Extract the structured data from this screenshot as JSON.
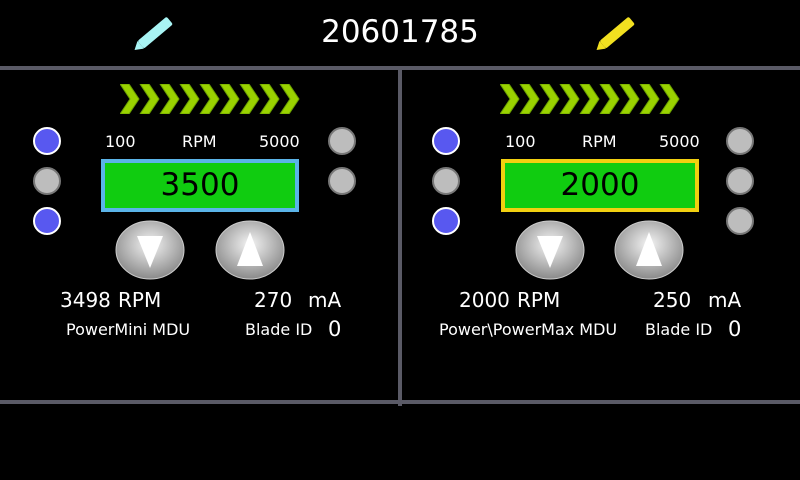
{
  "header": {
    "serial": "20601785",
    "left_pen_color": "#a8f4f4",
    "right_pen_color": "#f2e020",
    "left_pen_icon": "pen-icon",
    "right_pen_icon": "pen-icon"
  },
  "panels": [
    {
      "scale_min": "100",
      "scale_unit": "RPM",
      "scale_max": "5000",
      "setpoint": "3500",
      "display_border_color": "#5bb4e8",
      "actual_rpm": "3498",
      "rpm_unit": "RPM",
      "current": "270",
      "current_unit": "mA",
      "device_name": "PowerMini MDU",
      "blade_label": "Blade ID",
      "blade_id": "0",
      "left_indicators": [
        "on",
        "off",
        "on"
      ],
      "right_indicators": [
        "off",
        "off"
      ]
    },
    {
      "scale_min": "100",
      "scale_unit": "RPM",
      "scale_max": "5000",
      "setpoint": "2000",
      "display_border_color": "#f2d010",
      "actual_rpm": "2000",
      "rpm_unit": "RPM",
      "current": "250",
      "current_unit": "mA",
      "device_name": "Power\\PowerMax MDU",
      "blade_label": "Blade ID",
      "blade_id": "0",
      "left_indicators": [
        "on",
        "off",
        "on"
      ],
      "right_indicators": [
        "off",
        "off",
        "off"
      ]
    }
  ]
}
